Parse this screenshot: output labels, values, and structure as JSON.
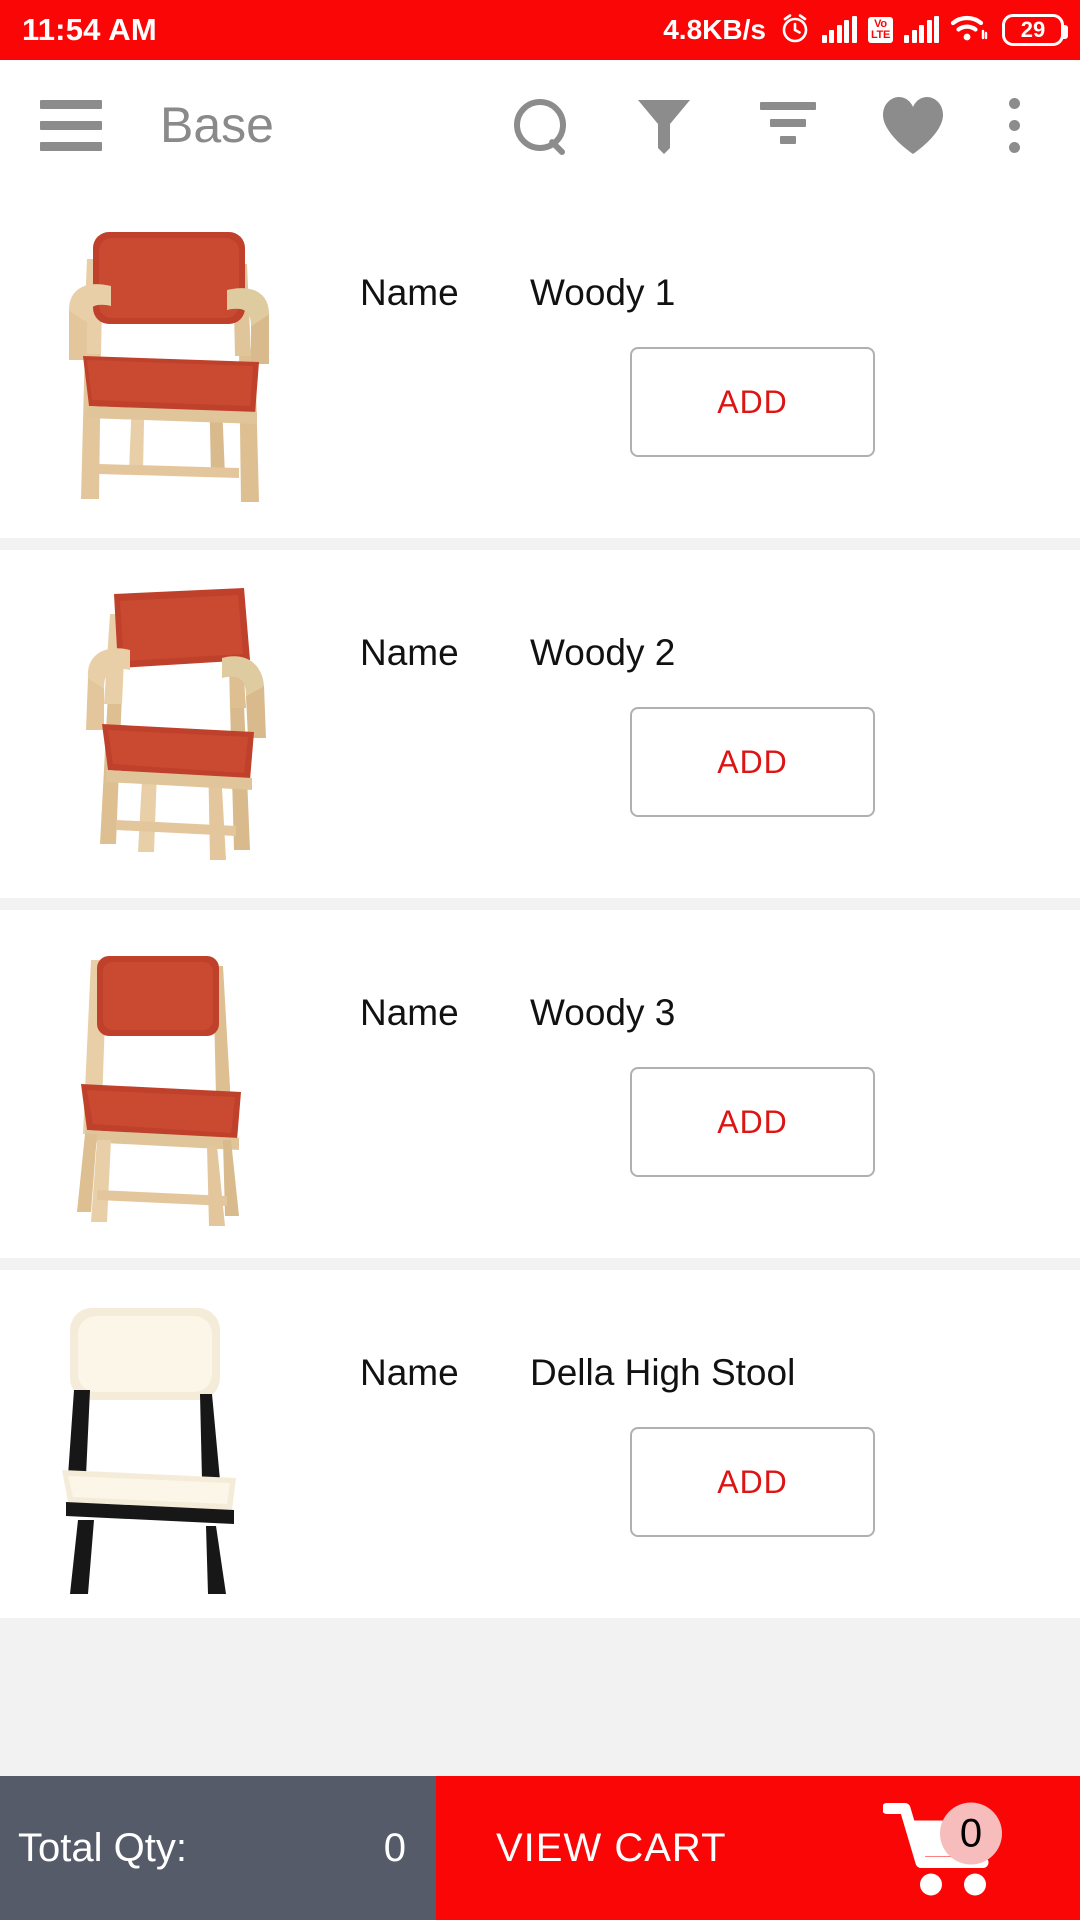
{
  "status_bar": {
    "time": "11:54 AM",
    "network_speed": "4.8KB/s",
    "alarm_icon": "alarm-clock-icon",
    "sim1_icon": "signal-bars-icon",
    "volte_line1": "Vo",
    "volte_line2": "LTE",
    "sim2_icon": "signal-bars-icon",
    "wifi_icon": "wifi-icon",
    "battery_percent": "29",
    "background_color": "#fb0606"
  },
  "toolbar": {
    "menu_icon": "hamburger-menu-icon",
    "title": "Base",
    "search_icon": "search-icon",
    "filter_icon": "funnel-filter-icon",
    "sort_icon": "sort-icon",
    "favorite_icon": "heart-icon",
    "overflow_icon": "more-vertical-icon",
    "icon_color": "#8c8c8c",
    "title_color": "#8a8a8a"
  },
  "products": [
    {
      "field_label": "Name",
      "name": "Woody 1",
      "add_label": "ADD",
      "image": "armchair-red-cushion-wood-frame"
    },
    {
      "field_label": "Name",
      "name": "Woody 2",
      "add_label": "ADD",
      "image": "armchair-red-cushion-wood-frame-angled"
    },
    {
      "field_label": "Name",
      "name": "Woody 3",
      "add_label": "ADD",
      "image": "side-chair-red-cushion-wood-frame"
    },
    {
      "field_label": "Name",
      "name": "Della High Stool",
      "add_label": "ADD",
      "image": "high-stool-cream-cushion-black-frame"
    }
  ],
  "bottom_bar": {
    "qty_label": "Total Qty:",
    "qty_value": "0",
    "view_cart_label": "VIEW CART",
    "cart_icon": "shopping-cart-icon",
    "cart_badge_count": "0",
    "qty_background_color": "#565b69",
    "cart_background_color": "#fb0606"
  },
  "theme": {
    "accent_red": "#fb0606",
    "add_text_red": "#dd1414",
    "page_background": "#f2f2f2",
    "card_background": "#ffffff"
  }
}
